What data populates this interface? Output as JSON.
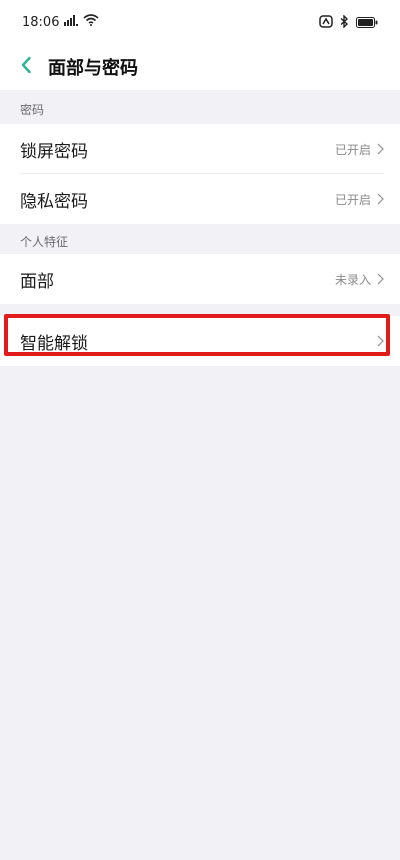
{
  "status_bar": {
    "time": "18:06",
    "icons": [
      "signal-icon",
      "wifi-icon",
      "nfc-icon",
      "bluetooth-icon",
      "battery-icon"
    ]
  },
  "header": {
    "back_icon": "chevron-left-icon",
    "title": "面部与密码"
  },
  "sections": {
    "password": {
      "label": "密码",
      "items": [
        {
          "label": "锁屏密码",
          "value": "已开启"
        },
        {
          "label": "隐私密码",
          "value": "已开启"
        }
      ]
    },
    "biometrics": {
      "label": "个人特征",
      "items": [
        {
          "label": "面部",
          "value": "未录入"
        }
      ]
    },
    "smart": {
      "items": [
        {
          "label": "智能解锁",
          "value": ""
        }
      ]
    }
  },
  "colors": {
    "accent": "#2bb596",
    "highlight": "#e21b1b",
    "background": "#f2f1f5"
  }
}
